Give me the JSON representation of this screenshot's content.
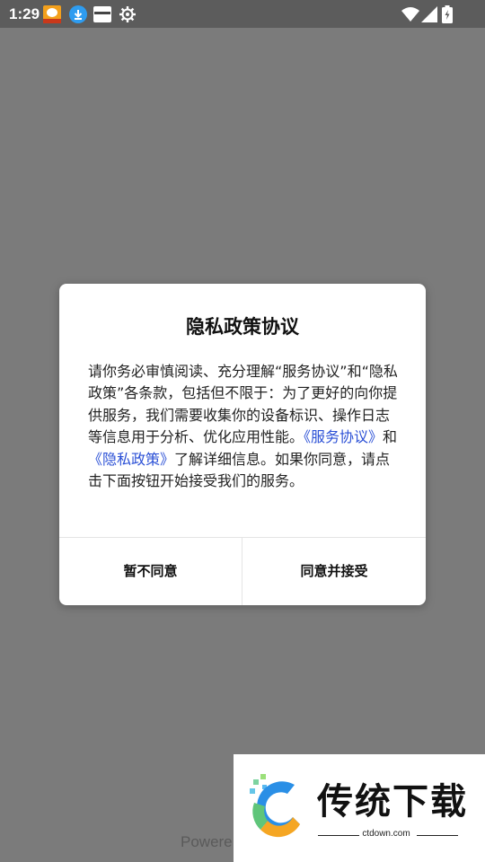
{
  "status_bar": {
    "time": "1:29",
    "icons": [
      "app-notification-icon",
      "download-icon",
      "app-notification-icon",
      "gear-icon",
      "wifi-icon",
      "signal-icon",
      "battery-charging-icon"
    ]
  },
  "background": {
    "footer_text": "Powere"
  },
  "dialog": {
    "title": "隐私政策协议",
    "body_part1": "请你务必审慎阅读、充分理解“服务协议”和“隐私政策”各条款，包括但不限于：为了更好的向你提供服务，我们需要收集你的设备标识、操作日志等信息用于分析、优化应用性能。",
    "link_service": "《服务协议》",
    "conj": "和",
    "link_privacy": "《隐私政策》",
    "body_part2": "了解详细信息。如果你同意，请点击下面按钮开始接受我们的服务。",
    "disagree_label": "暂不同意",
    "agree_label": "同意并接受"
  },
  "watermark": {
    "brand": "传统下载",
    "domain": "ctdown.com"
  },
  "colors": {
    "overlay": "#7b7b7b",
    "link": "#2b50d6",
    "dialog_bg": "#ffffff"
  }
}
